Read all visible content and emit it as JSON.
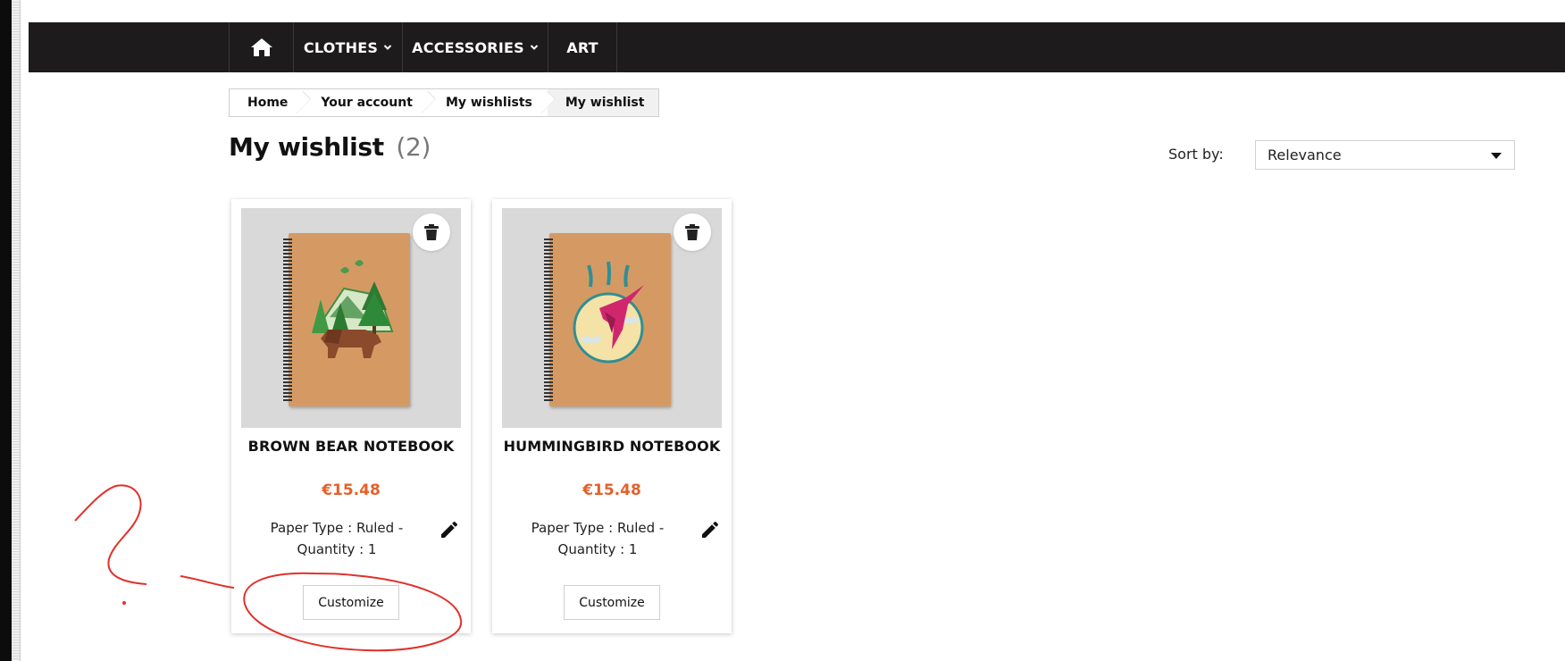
{
  "nav": {
    "home_icon": "home-icon",
    "items": [
      {
        "label": "CLOTHES",
        "has_dropdown": true
      },
      {
        "label": "ACCESSORIES",
        "has_dropdown": true
      },
      {
        "label": "ART",
        "has_dropdown": false
      }
    ]
  },
  "breadcrumb": [
    "Home",
    "Your account",
    "My wishlists",
    "My wishlist"
  ],
  "page": {
    "title": "My wishlist",
    "count": "(2)"
  },
  "sort": {
    "label": "Sort by:",
    "value": "Relevance"
  },
  "products": [
    {
      "name": "BROWN BEAR NOTEBOOK",
      "price": "€15.48",
      "attributes_line1": "Paper Type : Ruled -",
      "attributes_line2": "Quantity : 1",
      "button": "Customize",
      "image_icon": "brown-bear-illustration"
    },
    {
      "name": "HUMMINGBIRD NOTEBOOK",
      "price": "€15.48",
      "attributes_line1": "Paper Type : Ruled -",
      "attributes_line2": "Quantity : 1",
      "button": "Customize",
      "image_icon": "hummingbird-illustration"
    }
  ],
  "colors": {
    "nav_bg": "#1d1b1c",
    "price": "#e4602a",
    "annotation": "#e0302a"
  }
}
